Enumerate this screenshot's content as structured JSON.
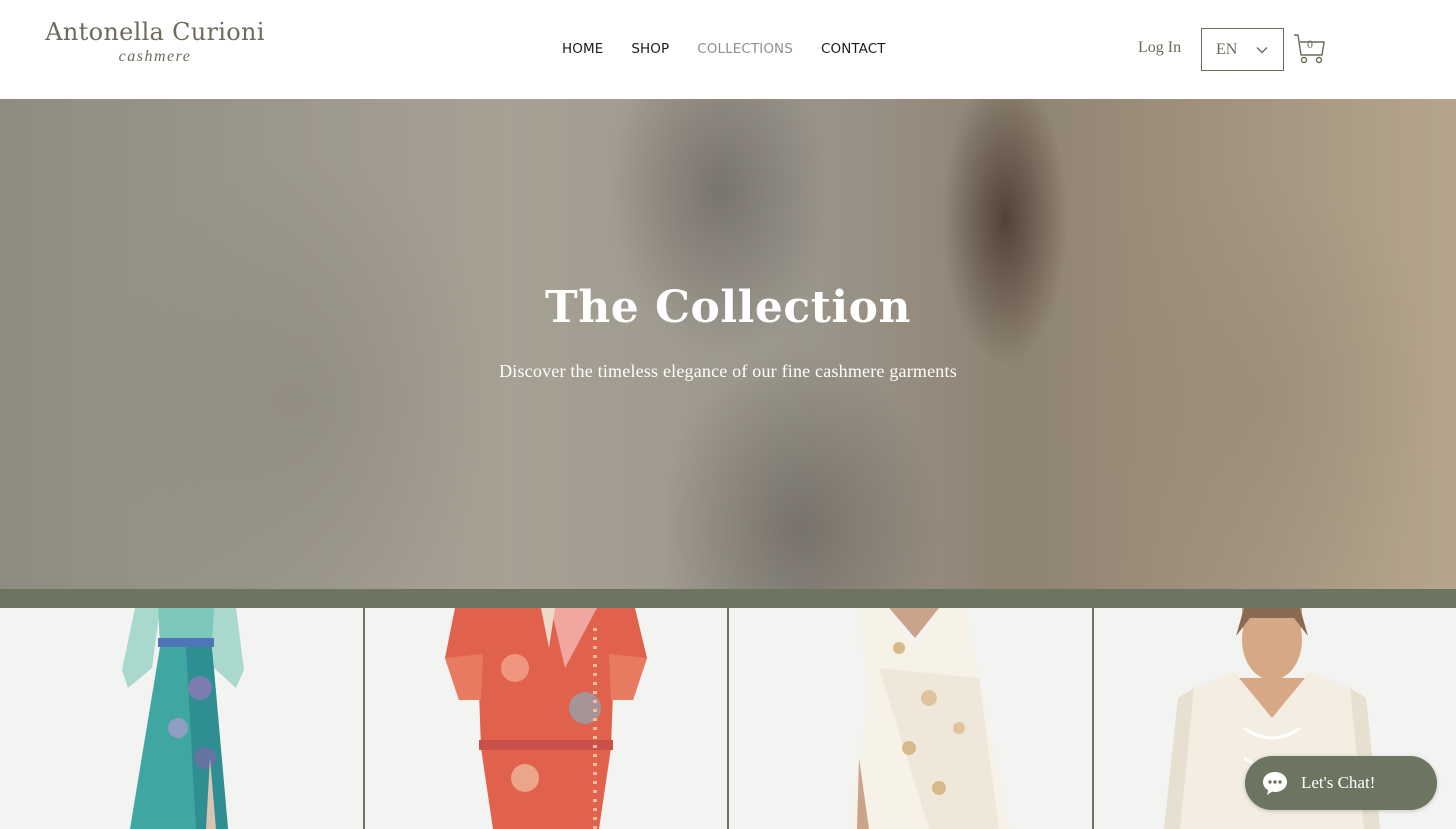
{
  "brand": {
    "name": "Antonella Curioni",
    "tagline": "cashmere"
  },
  "nav": [
    {
      "label": "HOME"
    },
    {
      "label": "SHOP"
    },
    {
      "label": "COLLECTIONS",
      "active": true
    },
    {
      "label": "CONTACT"
    }
  ],
  "header": {
    "login_label": "Log In",
    "language": "EN",
    "cart_count": "0"
  },
  "hero": {
    "title": "The Collection",
    "subtitle": "Discover the timeless elegance of our fine cashmere garments"
  },
  "gallery": {
    "items": [
      {
        "name": "turquoise-floral-gown"
      },
      {
        "name": "coral-print-dress"
      },
      {
        "name": "white-embroidered-dress"
      },
      {
        "name": "white-embroidered-blouse"
      }
    ]
  },
  "chat": {
    "label": "Let's Chat!"
  },
  "colors": {
    "accent": "#6b7560",
    "brand_text": "#6e6b5c",
    "nav_active": "#8f8f8f",
    "nav_text": "#1c1c1c"
  },
  "icons": [
    "chevron-down-icon",
    "cart-icon",
    "chat-bubble-icon"
  ]
}
